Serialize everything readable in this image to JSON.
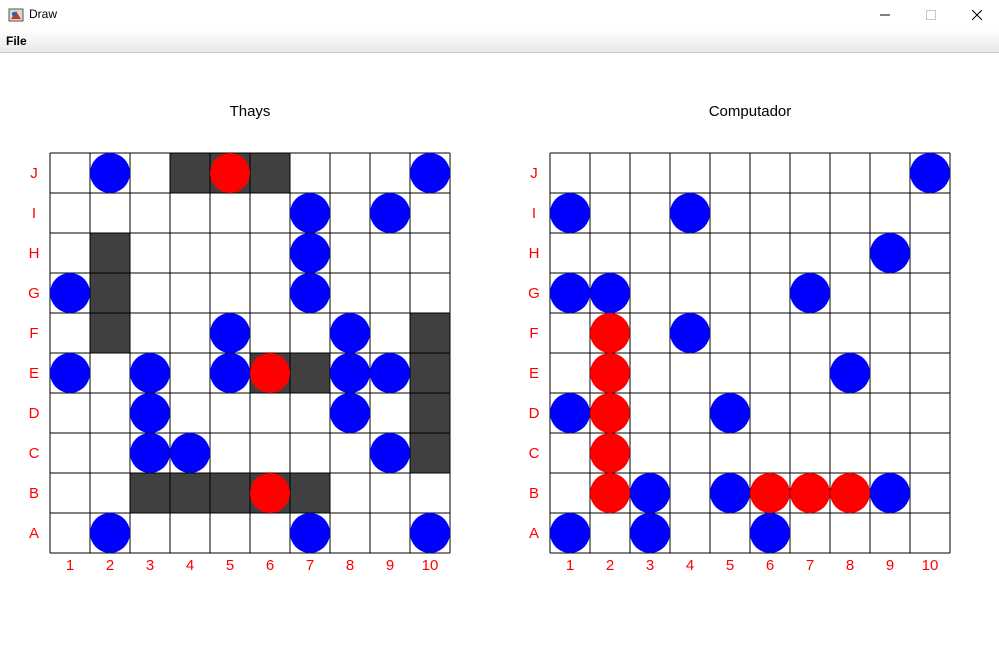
{
  "window": {
    "title": "Draw",
    "icon": "java-app-icon"
  },
  "menu": {
    "file_label": "File"
  },
  "colors": {
    "water": "#ffffff",
    "ship": "#404040",
    "miss": "#0000ff",
    "hit": "#ff0000",
    "grid": "#000000",
    "label": "#ff0000"
  },
  "row_labels": [
    "J",
    "I",
    "H",
    "G",
    "F",
    "E",
    "D",
    "C",
    "B",
    "A"
  ],
  "col_labels": [
    "1",
    "2",
    "3",
    "4",
    "5",
    "6",
    "7",
    "8",
    "9",
    "10"
  ],
  "boards": [
    {
      "title": "Thays",
      "ships": [
        "J4",
        "J5",
        "J6",
        "H2",
        "G2",
        "F2",
        "F10",
        "E10",
        "D10",
        "C10",
        "E6",
        "E7",
        "B3",
        "B4",
        "B5",
        "B6",
        "B7"
      ],
      "hits": [
        "J5",
        "E6",
        "B6"
      ],
      "misses": [
        "J2",
        "J10",
        "I7",
        "I9",
        "H7",
        "G1",
        "G7",
        "F5",
        "F8",
        "E1",
        "E3",
        "E5",
        "E8",
        "E9",
        "D3",
        "D8",
        "C3",
        "C4",
        "C9",
        "A2",
        "A7",
        "A10"
      ]
    },
    {
      "title": "Computador",
      "ships": [],
      "hits": [
        "F2",
        "E2",
        "D2",
        "C2",
        "B2",
        "B6",
        "B7",
        "B8"
      ],
      "misses": [
        "J10",
        "I1",
        "I4",
        "H9",
        "G1",
        "G2",
        "G7",
        "F4",
        "E8",
        "D1",
        "D5",
        "B3",
        "B5",
        "B9",
        "A1",
        "A3",
        "A6"
      ]
    }
  ]
}
